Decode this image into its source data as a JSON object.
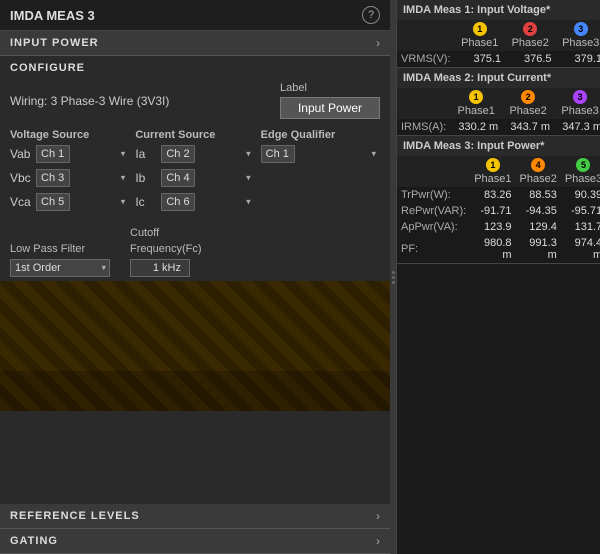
{
  "left": {
    "title": "IMDA MEAS 3",
    "help": "?",
    "input_power_label": "INPUT POWER",
    "configure_label": "CONFIGURE",
    "wiring_text": "Wiring: 3 Phase-3 Wire (3V3I)",
    "label_field": "Label",
    "label_value": "Input Power",
    "voltage_source_header": "Voltage Source",
    "current_source_header": "Current Source",
    "edge_qualifier_header": "Edge Qualifier",
    "channels": {
      "vab_label": "Vab",
      "vab_ch": "Ch 1",
      "vbc_label": "Vbc",
      "vbc_ch": "Ch 3",
      "vca_label": "Vca",
      "vca_ch": "Ch 5",
      "ia_label": "Ia",
      "ia_ch": "Ch 2",
      "ib_label": "Ib",
      "ib_ch": "Ch 4",
      "ic_label": "Ic",
      "ic_ch": "Ch 6",
      "edge_ch": "Ch 1"
    },
    "low_pass_label": "Low Pass Filter",
    "low_pass_value": "1st Order",
    "cutoff_label": "Cutoff",
    "frequency_label": "Frequency(Fc)",
    "cutoff_value": "1 kHz",
    "reference_levels_label": "REFERENCE LEVELS",
    "gating_label": "GATING"
  },
  "right": {
    "meas1_title": "IMDA Meas 1: Input Voltage*",
    "meas1_headers": [
      "",
      "Phase1",
      "Phase2",
      "Phase3"
    ],
    "meas1_row_label": "VRMS(V):",
    "meas1_phase1": "375.1",
    "meas1_phase2": "376.5",
    "meas1_phase3": "379.1",
    "meas2_title": "IMDA Meas 2: Input Current*",
    "meas2_headers": [
      "",
      "Phase1",
      "Phase2",
      "Phase3"
    ],
    "meas2_row_label": "IRMS(A):",
    "meas2_phase1": "330.2 m",
    "meas2_phase2": "343.7 m",
    "meas2_phase3": "347.3 m",
    "meas3_title": "IMDA Meas 3: Input Power*",
    "meas3_headers": [
      "",
      "Phase1",
      "Phase2",
      "Phase3"
    ],
    "meas3_rows": [
      {
        "label": "TrPwr(W):",
        "p1": "83.26",
        "p2": "88.53",
        "p3": "90.39"
      },
      {
        "label": "RePwr(VAR):",
        "p1": "-91.71",
        "p2": "-94.35",
        "p3": "-95.71"
      },
      {
        "label": "ApPwr(VA):",
        "p1": "123.9",
        "p2": "129.4",
        "p3": "131.7"
      },
      {
        "label": "PF:",
        "p1": "980.8 m",
        "p2": "991.3 m",
        "p3": "974.4 m"
      }
    ]
  }
}
